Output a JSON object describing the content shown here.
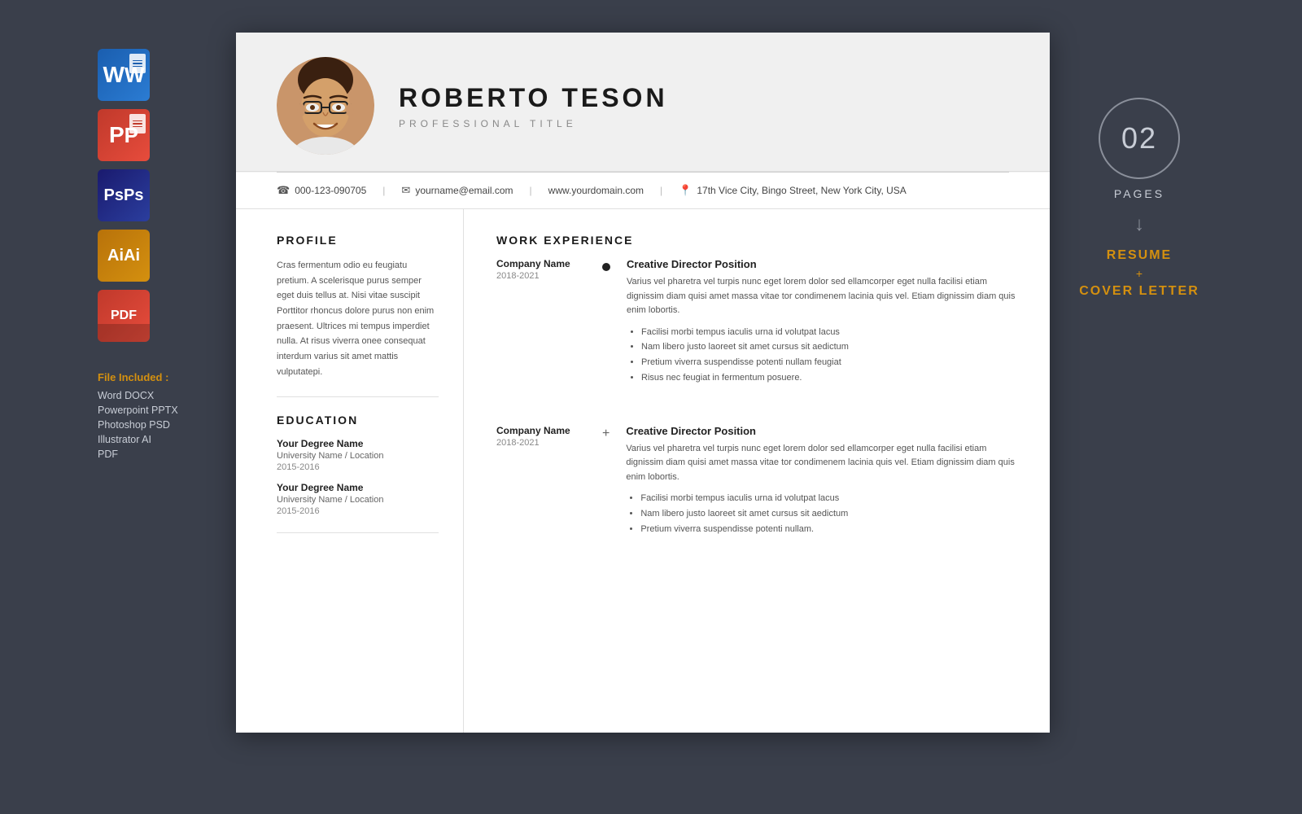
{
  "background_color": "#3a3f4b",
  "left_sidebar": {
    "file_icons": [
      {
        "id": "word",
        "label": "W",
        "color_class": "icon-word",
        "subtitle": "DOCX"
      },
      {
        "id": "ppt",
        "label": "P",
        "color_class": "icon-ppt",
        "subtitle": "PPTX"
      },
      {
        "id": "ps",
        "label": "Ps",
        "color_class": "icon-ps",
        "subtitle": "PSD"
      },
      {
        "id": "ai",
        "label": "Ai",
        "color_class": "icon-ai",
        "subtitle": "AI"
      },
      {
        "id": "pdf",
        "label": "PDF",
        "color_class": "icon-pdf",
        "subtitle": "PDF"
      }
    ],
    "files_included_title": "File Included :",
    "files_list": [
      "Word DOCX",
      "Powerpoint PPTX",
      "Photoshop PSD",
      "Illustrator AI",
      "PDF"
    ]
  },
  "right_sidebar": {
    "pages_number": "02",
    "pages_label": "PAGES",
    "resume_label": "RESUME",
    "plus_label": "+",
    "cover_label": "COVER LETTER"
  },
  "resume": {
    "header": {
      "name": "ROBERTO TESON",
      "title": "PROFESSIONAL TITLE"
    },
    "contact": {
      "phone": "000-123-090705",
      "email": "yourname@email.com",
      "website": "www.yourdomain.com",
      "address": "17th Vice City, Bingo Street, New York City, USA"
    },
    "profile": {
      "section_title": "PROFILE",
      "text": "Cras fermentum odio eu feugiatu pretium. A scelerisque purus semper eget duis tellus at. Nisi vitae suscipit Porttitor rhoncus dolore purus non enim praesent. Ultrices mi tempus imperdiet nulla. At risus viverra onee consequat interdum varius sit amet mattis vulputatepi."
    },
    "education": {
      "section_title": "EDUCATION",
      "entries": [
        {
          "degree": "Your Degree Name",
          "university": "University Name / Location",
          "years": "2015-2016"
        },
        {
          "degree": "Your Degree Name",
          "university": "University Name / Location",
          "years": "2015-2016"
        }
      ]
    },
    "work_experience": {
      "section_title": "WORK EXPERIENCE",
      "entries": [
        {
          "company": "Company Name",
          "dates": "2018-2021",
          "position": "Creative Director Position",
          "description": "Varius vel pharetra vel turpis nunc eget lorem dolor sed ellamcorper eget nulla facilisi etiam dignissim diam quisi amet massa vitae tor condimenem lacinia quis vel. Etiam dignissim diam quis enim lobortis.",
          "bullets": [
            "Facilisi morbi tempus iaculis urna id volutpat lacus",
            "Nam libero justo laoreet sit amet cursus sit aedictum",
            "Pretium viverra suspendisse potenti nullam feugiat",
            "Risus nec feugiat in fermentum posuere."
          ],
          "dot_type": "filled"
        },
        {
          "company": "Company Name",
          "dates": "2018-2021",
          "position": "Creative Director Position",
          "description": "Varius vel pharetra vel turpis nunc eget lorem dolor sed ellamcorper eget nulla facilisi etiam dignissim diam quisi amet massa vitae tor condimenem lacinia quis vel. Etiam dignissim diam quis enim lobortis.",
          "bullets": [
            "Facilisi morbi tempus iaculis urna id volutpat lacus",
            "Nam libero justo laoreet sit amet cursus sit aedictum",
            "Pretium viverra suspendisse potenti nullam."
          ],
          "dot_type": "plus"
        }
      ]
    }
  }
}
